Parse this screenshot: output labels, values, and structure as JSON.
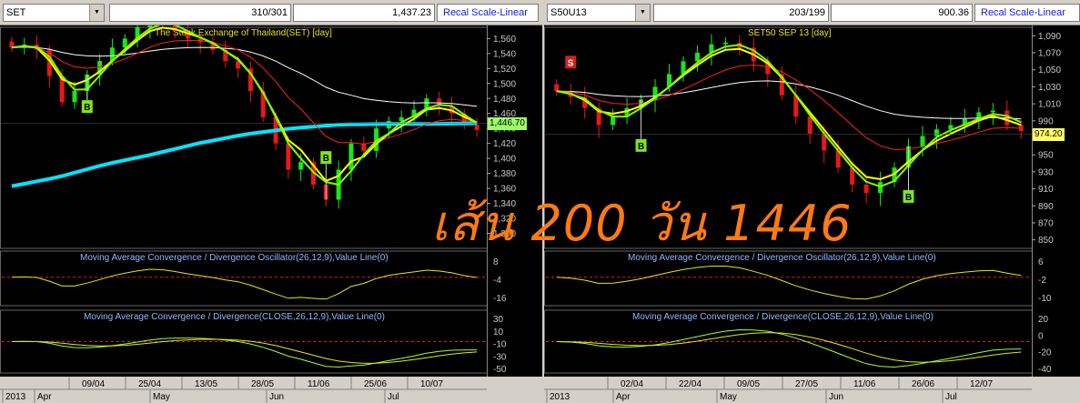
{
  "overlay_text": "เส้น 200 วัน 1446",
  "colors": {
    "price_tag_left": "#9cff66",
    "price_tag_right": "#ffff66",
    "ema_slow": "#00e5ff",
    "thin_slow": "#ffffff",
    "fast": "#ffff00",
    "mid": "#ff2020",
    "fast2": "#7fff00"
  },
  "chart_data": [
    {
      "type": "candlestick",
      "symbol": "SET",
      "field_counts": "310/301",
      "field_value": "1,437.23",
      "recal_label": "Recal Scale-Linear",
      "title": "The Stock Exchange of Thailand(SET) [day]",
      "price_tag": "1,446.70",
      "y_ticks": [
        "1,560",
        "1,540",
        "1,520",
        "1,500",
        "1,480",
        "1,460",
        "1,440",
        "1,420",
        "1,400",
        "1,380",
        "1,360",
        "1,340",
        "1,320",
        "1,300"
      ],
      "ylim": [
        1280,
        1575
      ],
      "x_labels": [
        "09/04",
        "25/04",
        "13/05",
        "28/05",
        "11/06",
        "25/06",
        "10/07"
      ],
      "month_labels": [
        "2013",
        "Apr",
        "May",
        "Jun",
        "Jul"
      ],
      "buy_markers": [
        "B",
        "B"
      ],
      "sell_markers": [],
      "osc1": {
        "title": "Moving Average Convergence / Divergence Oscillator(26,12,9),Value Line(0)",
        "ticks": [
          "8",
          "-4",
          "-16"
        ]
      },
      "osc2": {
        "title": "Moving Average Convergence / Divergence(CLOSE,26,12,9),Value Line(0)",
        "ticks": [
          "30",
          "10",
          "-10",
          "-30",
          "-50"
        ]
      },
      "closes": [
        1548,
        1552,
        1545,
        1510,
        1475,
        1490,
        1512,
        1530,
        1548,
        1560,
        1575,
        1585,
        1580,
        1570,
        1560,
        1555,
        1545,
        1530,
        1520,
        1490,
        1455,
        1420,
        1385,
        1395,
        1365,
        1345,
        1385,
        1420,
        1410,
        1440,
        1450,
        1455,
        1465,
        1480,
        1470,
        1460,
        1445,
        1438
      ]
    },
    {
      "type": "candlestick",
      "symbol": "S50U13",
      "field_counts": "203/199",
      "field_value": "900.36",
      "recal_label": "Recal Scale-Linear",
      "title": "SET50 SEP 13   [day]",
      "price_tag": "974.20",
      "y_ticks": [
        "1,090",
        "1,070",
        "1,050",
        "1,030",
        "1,010",
        "990",
        "970",
        "950",
        "930",
        "910",
        "890",
        "870",
        "850"
      ],
      "ylim": [
        840,
        1100
      ],
      "x_labels": [
        "02/04",
        "22/04",
        "09/05",
        "27/05",
        "11/06",
        "26/06",
        "12/07"
      ],
      "month_labels": [
        "2013",
        "Apr",
        "May",
        "Jun",
        "Jul"
      ],
      "buy_markers": [
        "B",
        "B"
      ],
      "sell_markers": [
        "S"
      ],
      "osc1": {
        "title": "Moving Average Convergence / Divergence Oscillator(26,12,9),Value Line(0)",
        "ticks": [
          "6",
          "-2",
          "-10"
        ]
      },
      "osc2": {
        "title": "Moving Average Convergence / Divergence(CLOSE,26,12,9),Value Line(0)",
        "ticks": [
          "20",
          "0",
          "-20",
          "-40"
        ]
      },
      "closes": [
        1025,
        1018,
        1005,
        985,
        995,
        1005,
        1015,
        1030,
        1045,
        1060,
        1070,
        1080,
        1082,
        1076,
        1060,
        1045,
        1020,
        995,
        975,
        955,
        935,
        915,
        905,
        918,
        935,
        960,
        972,
        980,
        985,
        992,
        1000,
        1002,
        985,
        978
      ]
    }
  ]
}
